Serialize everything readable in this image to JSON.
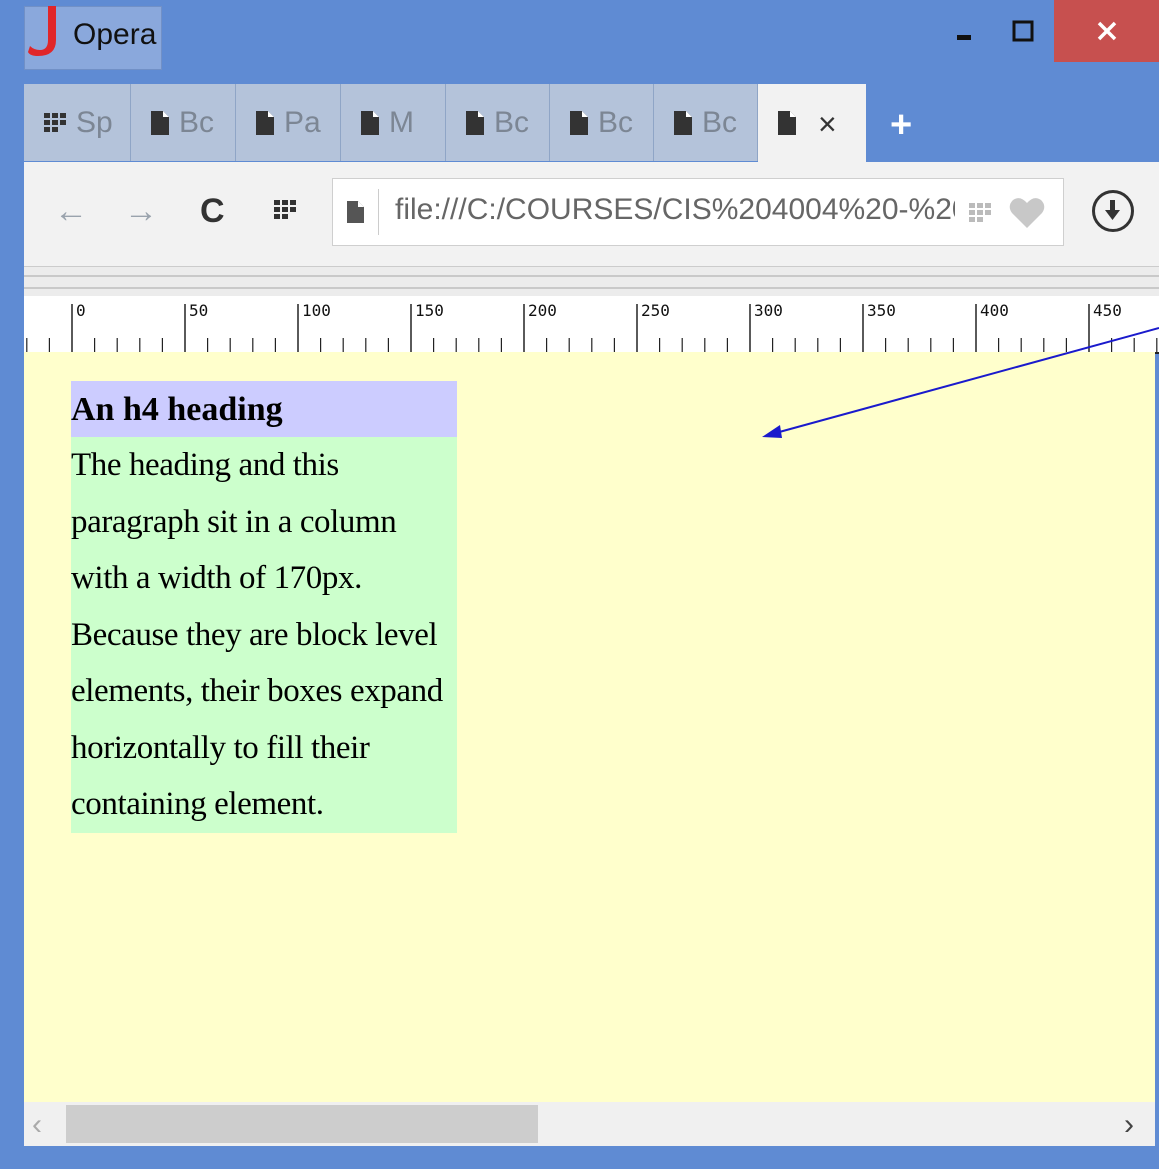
{
  "window": {
    "app_title": "Opera",
    "minimize_label": "‗",
    "maximize_label": "☐",
    "close_label": "✕"
  },
  "tabs": [
    {
      "label": "Sp",
      "icon": "speed-dial-icon"
    },
    {
      "label": "Bc",
      "icon": "page-icon"
    },
    {
      "label": "Pa",
      "icon": "page-icon"
    },
    {
      "label": "M",
      "icon": "page-icon"
    },
    {
      "label": "Bc",
      "icon": "page-icon"
    },
    {
      "label": "Bc",
      "icon": "page-icon"
    },
    {
      "label": "Bc",
      "icon": "page-icon"
    }
  ],
  "active_tab": {
    "close_label": "×",
    "icon": "page-icon"
  },
  "new_tab_label": "+",
  "nav": {
    "back": "←",
    "forward": "→",
    "reload": "C",
    "address": "file:///C:/COURSES/CIS%204004%20-%20W"
  },
  "ruler": {
    "labels": [
      "0",
      "50",
      "100",
      "150",
      "200",
      "250",
      "300",
      "350",
      "400",
      "450"
    ]
  },
  "page": {
    "heading": "An h4 heading",
    "paragraph": "The heading and this paragraph sit in a column with a width of 170px. Because they are block level elements, their boxes expand horizontally to fill their containing element."
  },
  "scrollbar": {
    "left": "‹",
    "right": "›",
    "position_fraction": 0.0
  },
  "colors": {
    "frame": "#5f8bd3",
    "close": "#c7504f",
    "page_bg": "#ffffcc",
    "heading_bg": "#ccccff",
    "paragraph_bg": "#ccffcc",
    "arrow": "#1a1acc"
  }
}
